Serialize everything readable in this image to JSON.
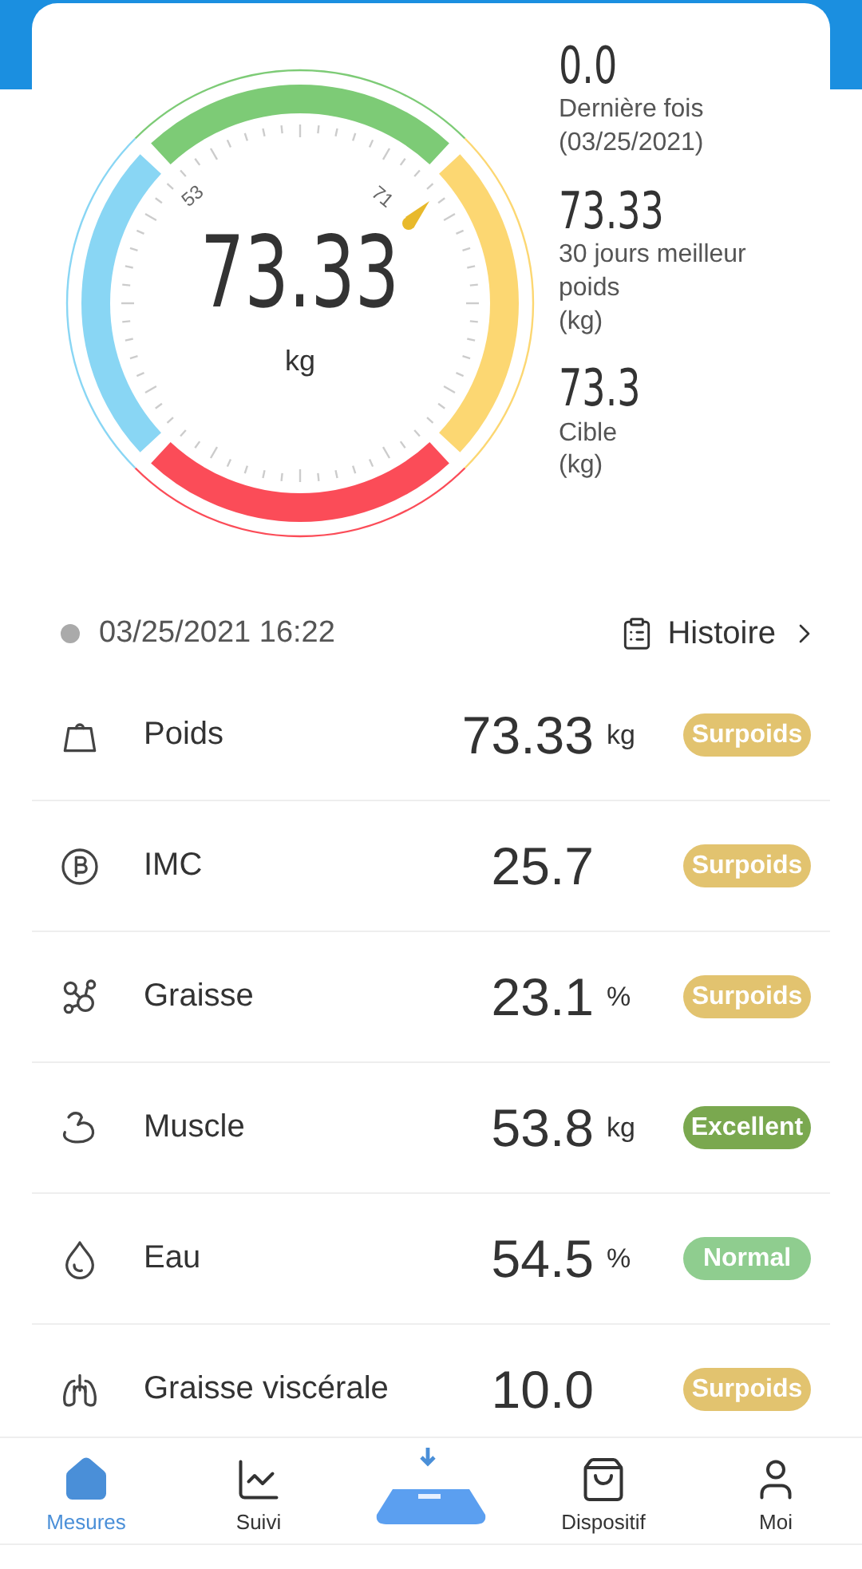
{
  "gauge": {
    "value": "73.33",
    "unit": "kg",
    "tick_low": "53",
    "tick_high": "71"
  },
  "stats": [
    {
      "value": "0.0",
      "label": "Dernière fois\n(03/25/2021)"
    },
    {
      "value": "73.33",
      "label": "30 jours meilleur\npoids\n(kg)"
    },
    {
      "value": "73.3",
      "label": "Cible\n(kg)"
    }
  ],
  "timestamp": "03/25/2021 16:22",
  "history_link": "Histoire",
  "metrics": [
    {
      "name": "Poids",
      "value": "73.33",
      "unit": "kg",
      "badge": "Surpoids",
      "color": "#e2c36f"
    },
    {
      "name": "IMC",
      "value": "25.7",
      "badge": "Surpoids",
      "color": "#e2c36f"
    },
    {
      "name": "Graisse",
      "value": "23.1",
      "unit": "%",
      "badge": "Surpoids",
      "color": "#e2c36f"
    },
    {
      "name": "Muscle",
      "value": "53.8",
      "unit": "kg",
      "badge": "Excellent",
      "color": "#7aa84f"
    },
    {
      "name": "Eau",
      "value": "54.5",
      "unit": "%",
      "badge": "Normal",
      "color": "#8fcd8f"
    },
    {
      "name": "Graisse viscérale",
      "value": "10.0",
      "badge": "Surpoids",
      "color": "#e2c36f"
    }
  ],
  "nav": [
    {
      "label": "Mesures",
      "kind": "home",
      "selected": true
    },
    {
      "label": "Suivi",
      "kind": "chart",
      "selected": false
    },
    {
      "kind": "scale",
      "selected": false
    },
    {
      "label": "Dispositif",
      "kind": "bag",
      "selected": false
    },
    {
      "label": "Moi",
      "kind": "user",
      "selected": false
    }
  ]
}
